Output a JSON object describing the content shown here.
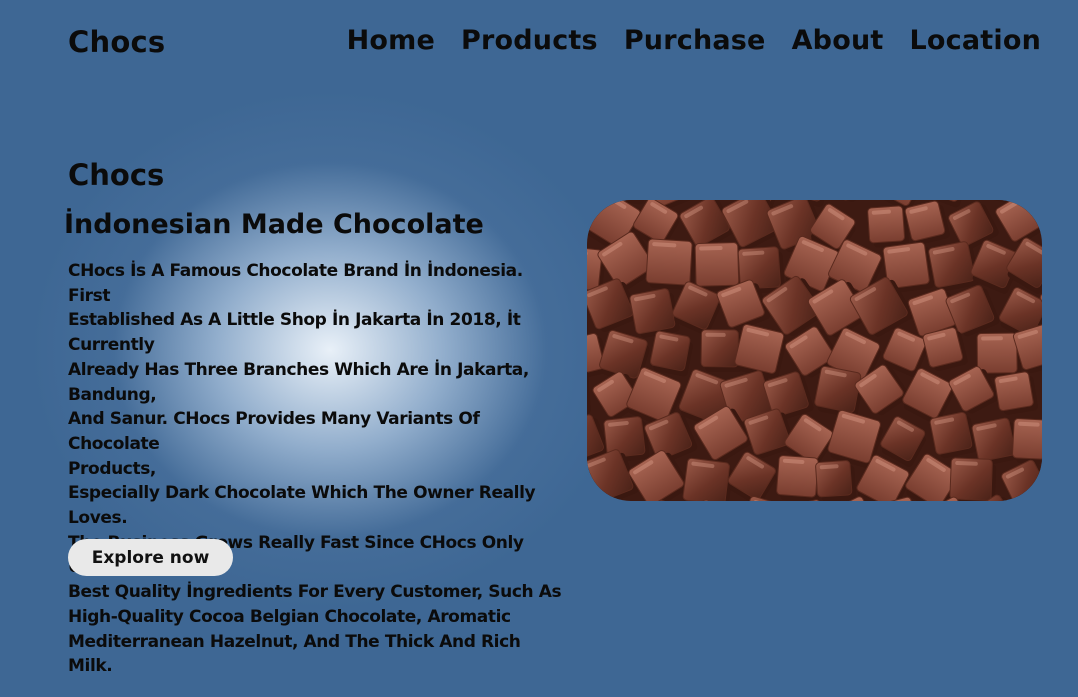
{
  "header": {
    "brand": "Chocs",
    "nav": [
      "Home",
      "Products",
      "Purchase",
      "About",
      "Location"
    ]
  },
  "hero": {
    "title": "Chocs",
    "subtitle": "İndonesian Made Chocolate",
    "description_lines": [
      "CHocs İs A Famous Chocolate Brand İn İndonesia. First",
      "Established As A Little Shop İn Jakarta İn 2018, İt Currently",
      "Already Has Three Branches Which Are İn Jakarta, Bandung,",
      "And Sanur. CHocs Provides Many Variants Of Chocolate",
      "Products,",
      "Especially Dark Chocolate Which The Owner Really Loves.",
      "The Business Grows Really Fast Since CHocs Only Uses The",
      "Best Quality İngredients For Every Customer, Such As",
      "High-Quality Cocoa Belgian Chocolate, Aromatic",
      "Mediterranean Hazelnut, And The Thick And Rich Milk."
    ],
    "button_label": "Explore now"
  },
  "colors": {
    "background": "#3e6794",
    "button": "#e9e9e9",
    "chocolate_dark": "#4a2218",
    "chocolate_mid": "#6b3326",
    "chocolate_light": "#9a5a49"
  }
}
